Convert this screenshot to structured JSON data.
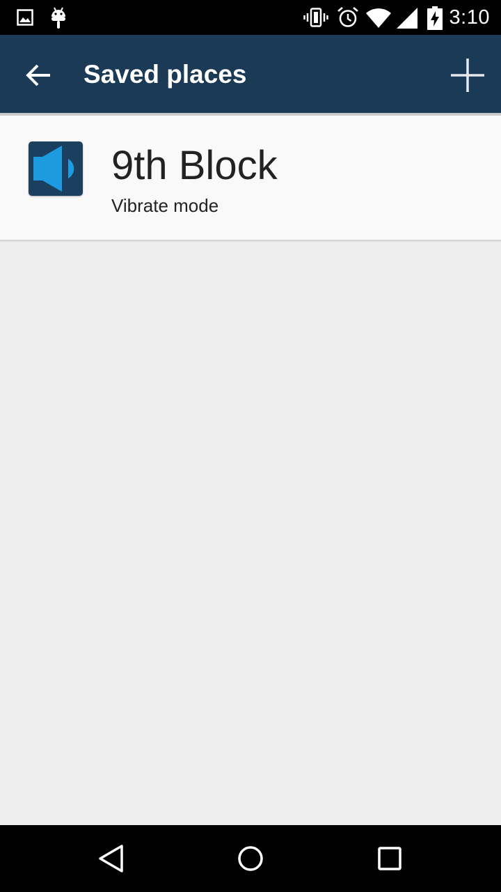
{
  "status_bar": {
    "time": "3:10",
    "icons": [
      "image-icon",
      "android-icon",
      "vibrate-icon",
      "alarm-icon",
      "wifi-icon",
      "signal-icon",
      "battery-charging-icon"
    ]
  },
  "toolbar": {
    "title": "Saved places",
    "back_icon": "arrow-back-icon",
    "add_icon": "add-icon",
    "background_color": "#1a3a56"
  },
  "places": [
    {
      "name": "9th Block",
      "mode": "Vibrate mode",
      "icon": "speaker-icon",
      "icon_color": "#1e9be0"
    }
  ],
  "nav_bar": {
    "buttons": [
      "back-triangle-icon",
      "home-circle-icon",
      "recents-square-icon"
    ]
  }
}
